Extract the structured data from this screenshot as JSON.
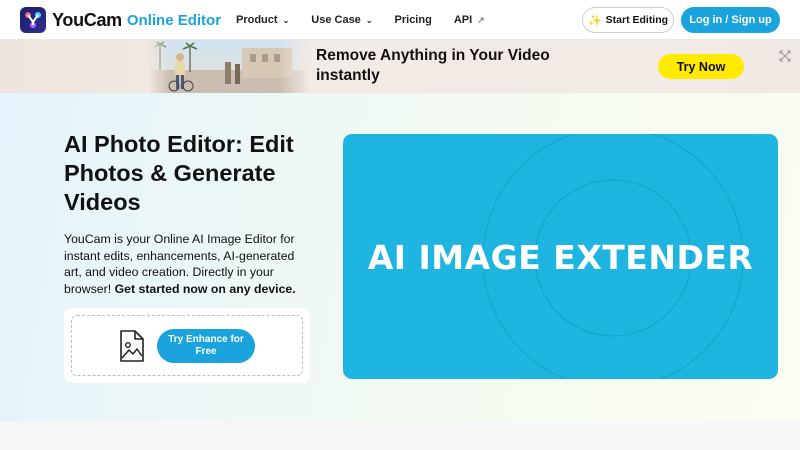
{
  "nav": {
    "brand": "YouCam",
    "brand_sub": "Online Editor",
    "menu": [
      {
        "label": "Product",
        "icon": "chevron-down-icon"
      },
      {
        "label": "Use Case",
        "icon": "chevron-down-icon"
      },
      {
        "label": "Pricing"
      },
      {
        "label": "API",
        "icon": "external-link-icon"
      }
    ],
    "start_editing": "Start Editing",
    "login": "Log in / Sign up"
  },
  "promo": {
    "title": "Remove Anything in Your Video instantly",
    "cta": "Try Now"
  },
  "hero": {
    "title": "AI Photo Editor: Edit Photos & Generate Videos",
    "desc": "YouCam is your Online AI Image Editor for instant edits, enhancements, AI-generated art, and video creation. Directly in your browser! ",
    "desc_bold": "Get started now on any device.",
    "upload_button": "Try Enhance for Free",
    "feature": "AI IMAGE EXTENDER"
  },
  "colors": {
    "accent": "#1aa3dd",
    "promo_button": "#ffea00",
    "feature_card": "#1eb6e0"
  }
}
